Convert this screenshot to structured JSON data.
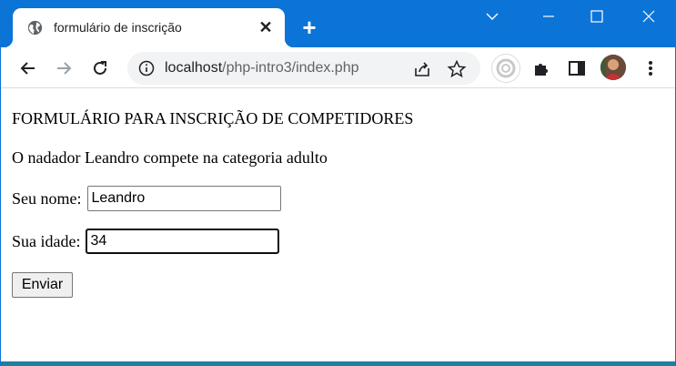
{
  "browser": {
    "tab": {
      "title": "formulário de inscrição",
      "favicon": "globe-icon",
      "close_icon": "close-icon"
    },
    "new_tab_icon": "plus-icon",
    "window_controls": [
      "chevron-down-icon",
      "minimize-icon",
      "maximize-icon",
      "close-window-icon"
    ],
    "address_bar": {
      "host": "localhost",
      "path": "/php-intro3/index.php",
      "info_icon": "info-icon"
    },
    "toolbar_icons": [
      "back-icon",
      "forward-icon",
      "reload-icon",
      "share-icon",
      "star-icon",
      "extension-ring-icon",
      "puzzle-icon",
      "side-panel-icon",
      "avatar",
      "menu-icon"
    ],
    "colors": {
      "frame": "#0b74d6",
      "omnibox": "#f1f3f4"
    }
  },
  "page": {
    "heading": "FORMULÁRIO PARA INSCRIÇÃO DE COMPETIDORES",
    "result_message": "O nadador Leandro compete na categoria adulto",
    "name_field": {
      "label": "Seu nome:",
      "value": "Leandro"
    },
    "age_field": {
      "label": "Sua idade:",
      "value": "34"
    },
    "submit_label": "Enviar"
  }
}
